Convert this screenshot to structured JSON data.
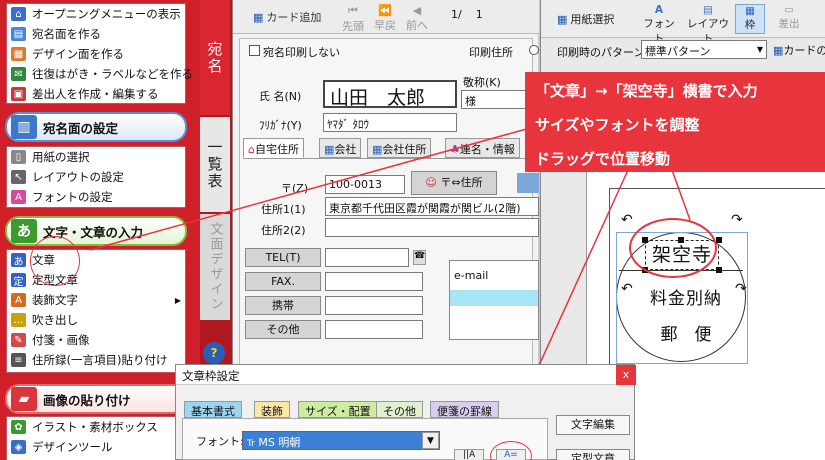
{
  "menu": {
    "top_items": [
      {
        "label": "オープニングメニューの表示",
        "icon": "home-icon"
      },
      {
        "label": "宛名面を作る",
        "icon": "address-icon"
      },
      {
        "label": "デザイン面を作る",
        "icon": "design-icon"
      },
      {
        "label": "往復はがき・ラベルなどを作る",
        "icon": "postcard-icon"
      },
      {
        "label": "差出人を作成・編集する",
        "icon": "sender-icon"
      }
    ],
    "address_section": {
      "title": "宛名面の設定",
      "items": [
        {
          "label": "用紙の選択"
        },
        {
          "label": "レイアウトの設定"
        },
        {
          "label": "フォントの設定"
        }
      ]
    },
    "text_section": {
      "title": "文字・文章の入力",
      "icon_glyph": "あ",
      "items": [
        {
          "label": "文章",
          "glyph": "あ"
        },
        {
          "label": "定型文章",
          "glyph": "定"
        },
        {
          "label": "装飾文字",
          "glyph": "A"
        },
        {
          "label": "吹き出し",
          "glyph": "…"
        },
        {
          "label": "付箋・画像",
          "glyph": "✎"
        },
        {
          "label": "住所録(一言項目)貼り付け",
          "glyph": "≡"
        }
      ]
    },
    "image_section": {
      "title": "画像の貼り付け",
      "items": [
        {
          "label": "イラスト・素材ボックス"
        },
        {
          "label": "デザインツール"
        }
      ]
    }
  },
  "side_tabs": {
    "address": "宛名",
    "list": "一覧表",
    "design": "文面デザイン"
  },
  "address_panel": {
    "toolbar": {
      "add_card": "カード追加",
      "first": "先頭",
      "prev_fast": "早戻",
      "prev": "前へ",
      "page_counter": "1/    1"
    },
    "no_print_label": "宛名印刷しない",
    "print_address_label": "印刷住所",
    "name_label": "氏 名(N)",
    "name_value": "山田　太郎",
    "honorific_label": "敬称(K)",
    "honorific_value": "様",
    "kana_label": "ﾌﾘｶﾞﾅ(Y)",
    "kana_value": "ﾔﾏﾀﾞ ﾀﾛｳ",
    "tabs": [
      "自宅住所",
      "会社",
      "会社住所",
      "連名・情報"
    ],
    "zip_label": "〒(Z)",
    "zip_value": "100-0013",
    "zip_button": "〒⇔住所",
    "addr1_label": "住所1(1)",
    "addr1_value": "東京都千代田区霞が関霞が関ビル(2階)",
    "addr2_label": "住所2(2)",
    "tel_label": "TEL(T)",
    "fax_label": "FAX.",
    "mobile_label": "携帯",
    "other_label": "その他",
    "email_label": "e-mail"
  },
  "preview": {
    "toolbar": {
      "paper_select": "用紙選択",
      "font": "フォント",
      "layout": "レイアウト",
      "frame": "枠",
      "sender": "差出"
    },
    "pattern_label": "印刷時のパターン",
    "pattern_value": "標準パターン",
    "card_label": "カードの",
    "stamp_lines": [
      "架空寺",
      "料金別納",
      "郵　便"
    ]
  },
  "callout": {
    "line1": "「文章」→「架空寺」横書で入力",
    "line2": "サイズやフォントを調整",
    "line3": "ドラッグで位置移動"
  },
  "dialog": {
    "title": "文章枠設定",
    "close": "x",
    "tabs": [
      "基本書式",
      "装飾",
      "サイズ・配置",
      "その他",
      "便箋の罫線"
    ],
    "font_label": "フォント:",
    "font_value": "MS 明朝",
    "text_edit_button": "文字編集",
    "fixed_text_button": "定型文章"
  },
  "colors": {
    "menu_red": "#cf1f28",
    "callout_red": "#e8343c",
    "selection_blue": "#3c7fd6"
  }
}
